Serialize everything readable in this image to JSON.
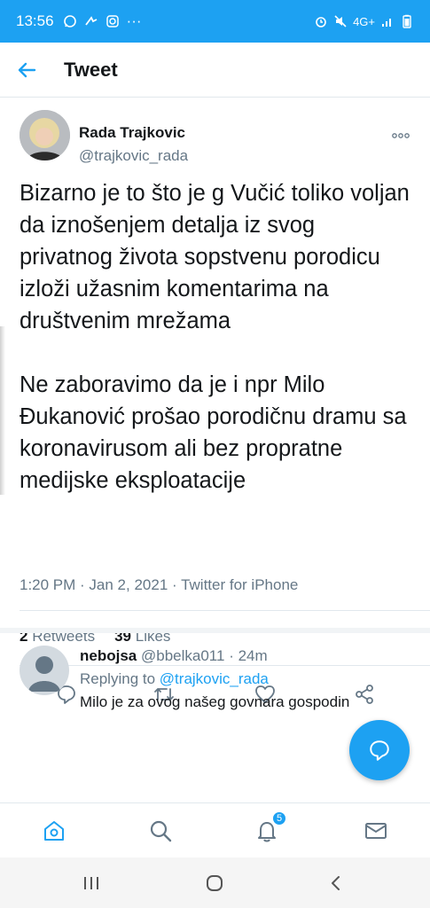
{
  "status_bar": {
    "time": "13:56",
    "more": "···",
    "network": "4G+"
  },
  "header": {
    "title": "Tweet"
  },
  "tweet": {
    "author_name": "Rada Trajkovic",
    "author_handle": "@trajkovic_rada",
    "text_p1": "Bizarno je to što je g Vučić toliko voljan da iznošenjem detalja iz svog privatnog života sopstvenu porodicu izloži užasnim komentarima na društvenim mrežama",
    "text_p2": "Ne zaboravimo da je i npr Milo Đukanović prošao porodičnu dramu sa koronavirusom ali bez propratne medijske eksploatacije",
    "timestamp": "1:20 PM · Jan 2, 2021 · Twitter for iPhone",
    "retweets_count": "2",
    "retweets_label": "Retweets",
    "likes_count": "39",
    "likes_label": "Likes"
  },
  "reply": {
    "name": "nebojsa",
    "handle": "@bbelka011",
    "time": "· 24m",
    "replying_label": "Replying to",
    "replying_handle": "@trajkovic_rada",
    "text": "Milo je za ovog našeg govnara gospodin"
  },
  "bottom_nav": {
    "notifications_badge": "5"
  },
  "colors": {
    "brand": "#1da1f2",
    "text": "#14171a",
    "secondary": "#657786",
    "divider": "#e1e8ed"
  }
}
